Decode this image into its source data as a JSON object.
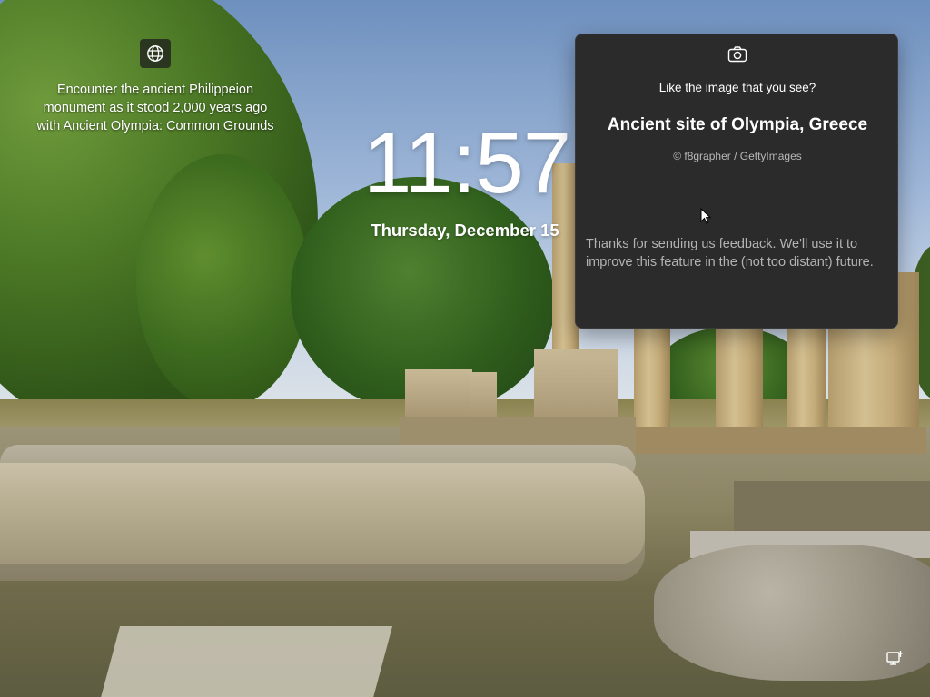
{
  "spotlight": {
    "icon": "globe-icon",
    "description": "Encounter the ancient Philippeion monument as it stood 2,000 years ago with Ancient Olympia: Common Grounds"
  },
  "lockscreen": {
    "time": "11:57",
    "date": "Thursday, December 15"
  },
  "feedback_panel": {
    "icon": "camera-icon",
    "prompt": "Like the image that you see?",
    "title": "Ancient site of Olympia, Greece",
    "credit": "© f8grapher / GettyImages",
    "thanks": "Thanks for sending us feedback. We'll use it to improve this feature in the (not too distant) future."
  },
  "system_tray": {
    "icon": "network-icon"
  },
  "colors": {
    "panel_bg": "#2b2b2b",
    "panel_text_secondary": "#b3b3b3",
    "text_primary": "#ffffff"
  }
}
